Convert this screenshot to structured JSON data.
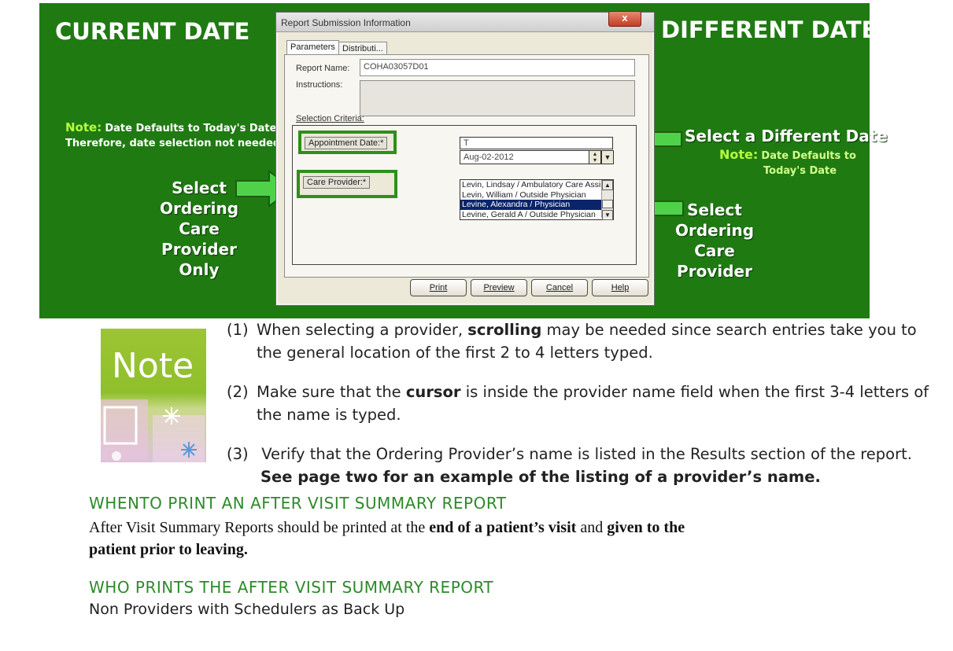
{
  "banner": {
    "left_title": "CURRENT DATE",
    "right_title": "DIFFERENT DATE",
    "left_note_label": "Note:",
    "left_note_line1": "Date Defaults to Today's Date",
    "left_note_line2": "Therefore, date selection not needed.",
    "left_callout": [
      "Select",
      "Ordering",
      "Care",
      "Provider",
      "Only"
    ],
    "right_callout_date": "Select a Different Date",
    "right_note_label": "Note:",
    "right_note_line1": "Date Defaults to",
    "right_note_line2": "Today's Date",
    "right_callout_provider": [
      "Select",
      "Ordering",
      "Care",
      "Provider"
    ],
    "colors": {
      "banner_bg": "#1f7a12",
      "arrow": "#3fc43a",
      "note_label": "#b6ff3c"
    }
  },
  "dialog": {
    "title": "Report Submission Information",
    "close_label": "x",
    "tabs": [
      {
        "label": "Parameters",
        "active": true
      },
      {
        "label": "Distributi...",
        "active": false
      }
    ],
    "report_name_label": "Report Name:",
    "report_name_value": "COHA03057D01",
    "instructions_label": "Instructions:",
    "instructions_value": "",
    "selection_criteria_label": "Selection Criteria:",
    "appointment_date_label": "Appointment Date:*",
    "date_text_value": "T",
    "date_spinner_value": "Aug-02-2012",
    "care_provider_label": "Care Provider:*",
    "provider_list": [
      {
        "name": "Levin, Lindsay / Ambulatory Care Assist",
        "selected": false
      },
      {
        "name": "Levin, William / Outside Physician",
        "selected": false
      },
      {
        "name": "Levine, Alexandra / Physician",
        "selected": true
      },
      {
        "name": "Levine, Gerald A / Outside Physician",
        "selected": false
      }
    ],
    "buttons": [
      "Print",
      "Preview",
      "Cancel",
      "Help"
    ]
  },
  "note_image": {
    "word": "Note"
  },
  "notes": [
    {
      "num": "(1)",
      "line1_pre": "When selecting a provider, ",
      "line1_bold": "scrolling",
      "line1_post": " may be needed since search entries take you to",
      "line2": "the general location of the first 2 to 4 letters typed."
    },
    {
      "num": "(2)",
      "line1_pre": "Make sure that the ",
      "line1_bold": "cursor",
      "line1_post": " is inside the provider name field when the first 3-4 letters of",
      "line2": "the name is typed."
    },
    {
      "num": "(3)",
      "line1_pre": " Verify that the Ordering Provider’s name is listed in the Results section of the report.",
      "line1_bold": "",
      "line1_post": "",
      "line2": "See page two for an example of the listing of a provider’s name."
    }
  ],
  "section1": {
    "heading": "WHENTO PRINT AN AFTER VISIT SUMMARY REPORT",
    "body_pre": "After Visit Summary Reports should be printed at the ",
    "body_bold1": "end of a patient’s visit",
    "body_mid": " and ",
    "body_bold2": "given to the",
    "body_line2_bold": "patient prior to leaving."
  },
  "section2": {
    "heading": "WHO PRINTS THE AFTER VISIT SUMMARY REPORT",
    "body": "Non Providers with Schedulers as Back Up"
  }
}
